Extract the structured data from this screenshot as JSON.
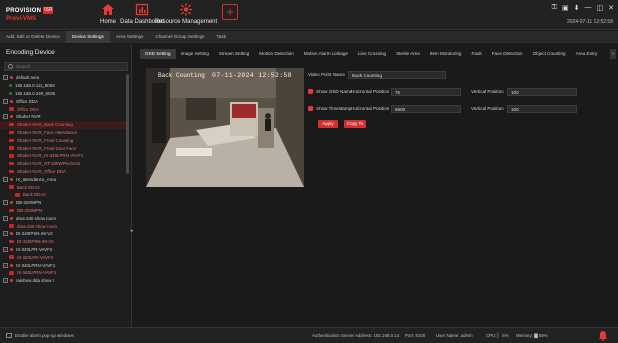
{
  "app": {
    "brand_top": "PROVISION",
    "brand_badge": "ISR",
    "brand_sub": "Provi-VMS",
    "datetime": "2024-07-11 12:52:58",
    "window_controls": [
      "⚿",
      "▣",
      "⬇",
      "—",
      "◫",
      "✕"
    ]
  },
  "nav": {
    "home": "Home",
    "dashboard": "Data Dashboard",
    "resource": "Resource Management",
    "add": "+"
  },
  "subtabs": [
    "Add, Edit or Delete Device",
    "Device Settings",
    "Area Settings",
    "Channel Group Settings",
    "Task"
  ],
  "left": {
    "title": "Encoding Device",
    "search_placeholder": "Search",
    "tree": [
      {
        "label": "default area",
        "level": 0,
        "kind": "area"
      },
      {
        "label": "192.168.0.111_8008",
        "level": 1,
        "kind": "dev-green"
      },
      {
        "label": "192.168.0.249_6036",
        "level": 1,
        "kind": "dev-green"
      },
      {
        "label": "Office DDA",
        "level": 0,
        "kind": "area"
      },
      {
        "label": "Office DDA",
        "level": 1,
        "kind": "cam"
      },
      {
        "label": "Shaher NVR",
        "level": 0,
        "kind": "area"
      },
      {
        "label": "Shaher NVR_Back Counting",
        "level": 1,
        "kind": "cam",
        "selected": true
      },
      {
        "label": "Shaher NVR_Face Attendance",
        "level": 1,
        "kind": "cam"
      },
      {
        "label": "Shaher NVR_Front Counting",
        "level": 1,
        "kind": "cam"
      },
      {
        "label": "Shaher NVR_Front Door Face",
        "level": 1,
        "kind": "cam"
      },
      {
        "label": "Shaher NVR_IX-340LPRN-VAVF1",
        "level": 1,
        "kind": "cam"
      },
      {
        "label": "Shaher NVR_NT-320WPN-Dock",
        "level": 1,
        "kind": "cam"
      },
      {
        "label": "Shaher NVR_Office DDA",
        "level": 1,
        "kind": "cam"
      },
      {
        "label": "IX_attendance_Area",
        "level": 0,
        "kind": "area"
      },
      {
        "label": "Back DDA2",
        "level": 1,
        "kind": "cam"
      },
      {
        "label": "Back DDA2",
        "level": 2,
        "kind": "cam"
      },
      {
        "label": "DB-320WPN",
        "level": 0,
        "kind": "area"
      },
      {
        "label": "DB-320WPN",
        "level": 1,
        "kind": "cam"
      },
      {
        "label": "dma-340 show room",
        "level": 0,
        "kind": "area"
      },
      {
        "label": "dma-340 show room",
        "level": 1,
        "kind": "cam"
      },
      {
        "label": "DI-340IPSN-28-V2",
        "level": 0,
        "kind": "area"
      },
      {
        "label": "DI-340IPSN-28-V2",
        "level": 1,
        "kind": "cam"
      },
      {
        "label": "IX-320LPR-VAVF2",
        "level": 0,
        "kind": "area"
      },
      {
        "label": "IX-320LPR-VAVF2",
        "level": 1,
        "kind": "cam"
      },
      {
        "label": "IX-340LPRN-VAVF1",
        "level": 0,
        "kind": "area"
      },
      {
        "label": "IX-340LPRN-VAVF1",
        "level": 1,
        "kind": "cam"
      },
      {
        "label": "rainbow dda show r",
        "level": 0,
        "kind": "area"
      }
    ]
  },
  "main": {
    "tabs": [
      "OSD Setting",
      "Image Setting",
      "Stream Setting",
      "Motion Detection",
      "Motion Alarm Linkage",
      "Line Crossing",
      "Sterile Area",
      "Item Monitoring",
      "Fault",
      "Face Detection",
      "Object Counting",
      "Area Entry"
    ],
    "video_osd_name": "Back Counting",
    "video_osd_time": "07-11-2024 12:52:58",
    "form": {
      "video_point_name_label": "Video Point Name",
      "video_point_name_value": "Back Counting",
      "show_osd_name_label": "Show OSD Name",
      "h_pos_label": "Horizontal Position",
      "h_pos_osd": "75",
      "v_pos_label": "Vertical Position",
      "v_pos_osd": "100",
      "show_timestamp_label": "Show Timestamp",
      "h_pos_time": "6600",
      "v_pos_time": "100",
      "apply": "Apply",
      "copy_to": "Copy To"
    }
  },
  "status": {
    "enable_alarm": "Enable alarm pop-up windows",
    "auth_server": "Authentication Server Address: 192.168.0.14",
    "port": "Port: 6100",
    "user": "User Name: admin",
    "cpu": "CPU: ▏ 6%",
    "memory": "Memory: ▇ 58%"
  },
  "colors": {
    "accent": "#d32f2f",
    "background": "#1a1a1a",
    "online": "#2e7d32"
  }
}
